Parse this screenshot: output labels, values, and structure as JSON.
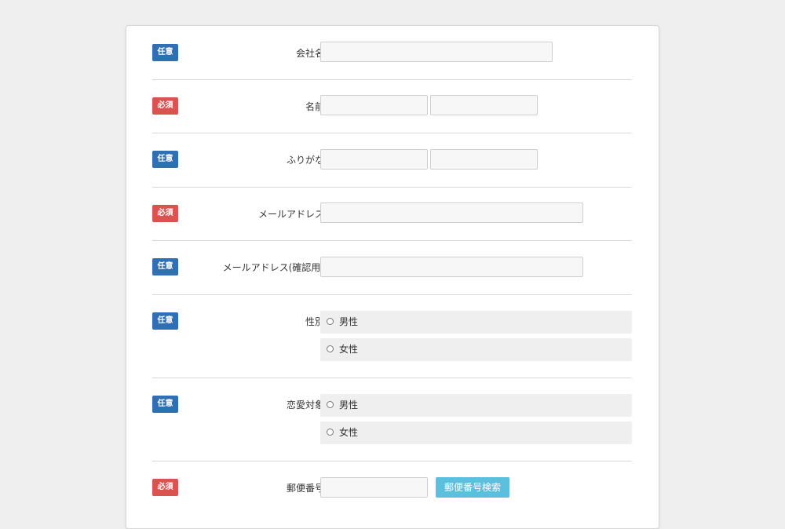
{
  "badges": {
    "optional": "任意",
    "required": "必須"
  },
  "fields": {
    "company": {
      "label": "会社名"
    },
    "name": {
      "label": "名前"
    },
    "furigana": {
      "label": "ふりがな"
    },
    "email": {
      "label": "メールアドレス"
    },
    "email_confirm": {
      "label": "メールアドレス(確認用)"
    },
    "gender": {
      "label": "性別",
      "options": [
        "男性",
        "女性"
      ]
    },
    "romance_target": {
      "label": "恋愛対象",
      "options": [
        "男性",
        "女性"
      ]
    },
    "postal_code": {
      "label": "郵便番号",
      "button": "郵便番号検索"
    }
  },
  "colors": {
    "optional_badge": "#2f6fb3",
    "required_badge": "#d9534f",
    "search_button": "#5bc0de"
  }
}
